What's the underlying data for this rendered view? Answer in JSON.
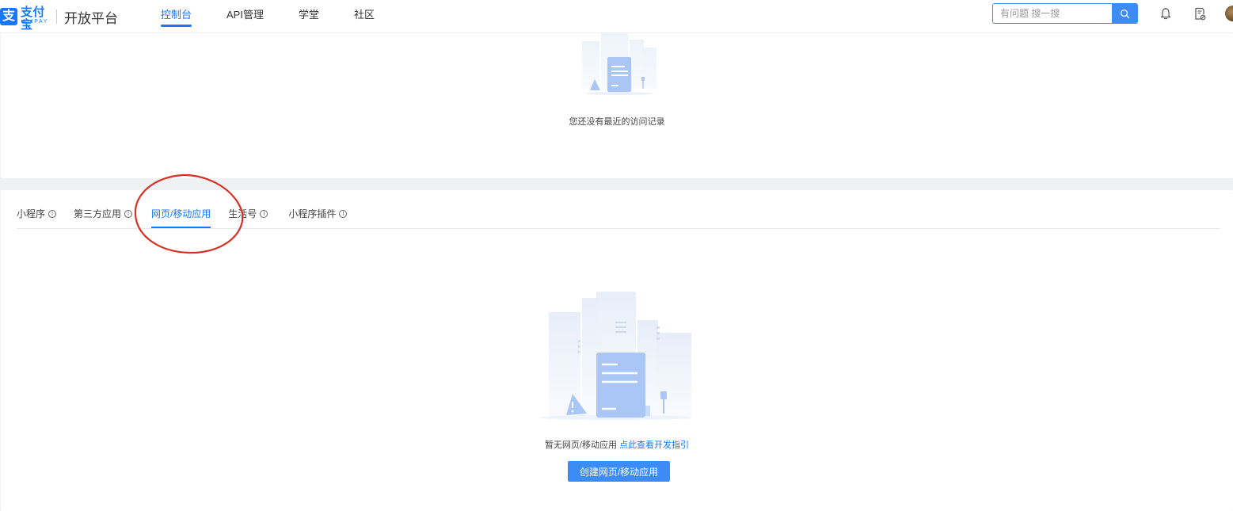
{
  "brand": {
    "logo_glyph": "支",
    "logo_cn": "支付宝",
    "logo_en": "ALIPAY",
    "platform": "开放平台",
    "accent_color": "#1677ff"
  },
  "nav": {
    "items": [
      {
        "label": "控制台",
        "active": true
      },
      {
        "label": "API管理",
        "active": false
      },
      {
        "label": "学堂",
        "active": false
      },
      {
        "label": "社区",
        "active": false
      }
    ]
  },
  "search": {
    "placeholder": "有问题 搜一搜",
    "button_icon": "search-icon"
  },
  "header_icons": [
    "bell-icon",
    "task-document-icon",
    "avatar"
  ],
  "recent": {
    "empty_text": "您还没有最近的访问记录"
  },
  "tabs": [
    {
      "label": "小程序",
      "info": "ⓘ",
      "active": false
    },
    {
      "label": "第三方应用",
      "info": "ⓘ",
      "active": false
    },
    {
      "label": "网页/移动应用",
      "info": "",
      "active": true
    },
    {
      "label": "生活号",
      "info": "ⓘ",
      "active": false
    },
    {
      "label": "小程序插件",
      "info": "ⓘ",
      "active": false
    }
  ],
  "main": {
    "empty_text": "暂无网页/移动应用",
    "guide_link": "点此查看开发指引",
    "create_button": "创建网页/移动应用"
  },
  "annotation": {
    "color": "#d93025"
  }
}
